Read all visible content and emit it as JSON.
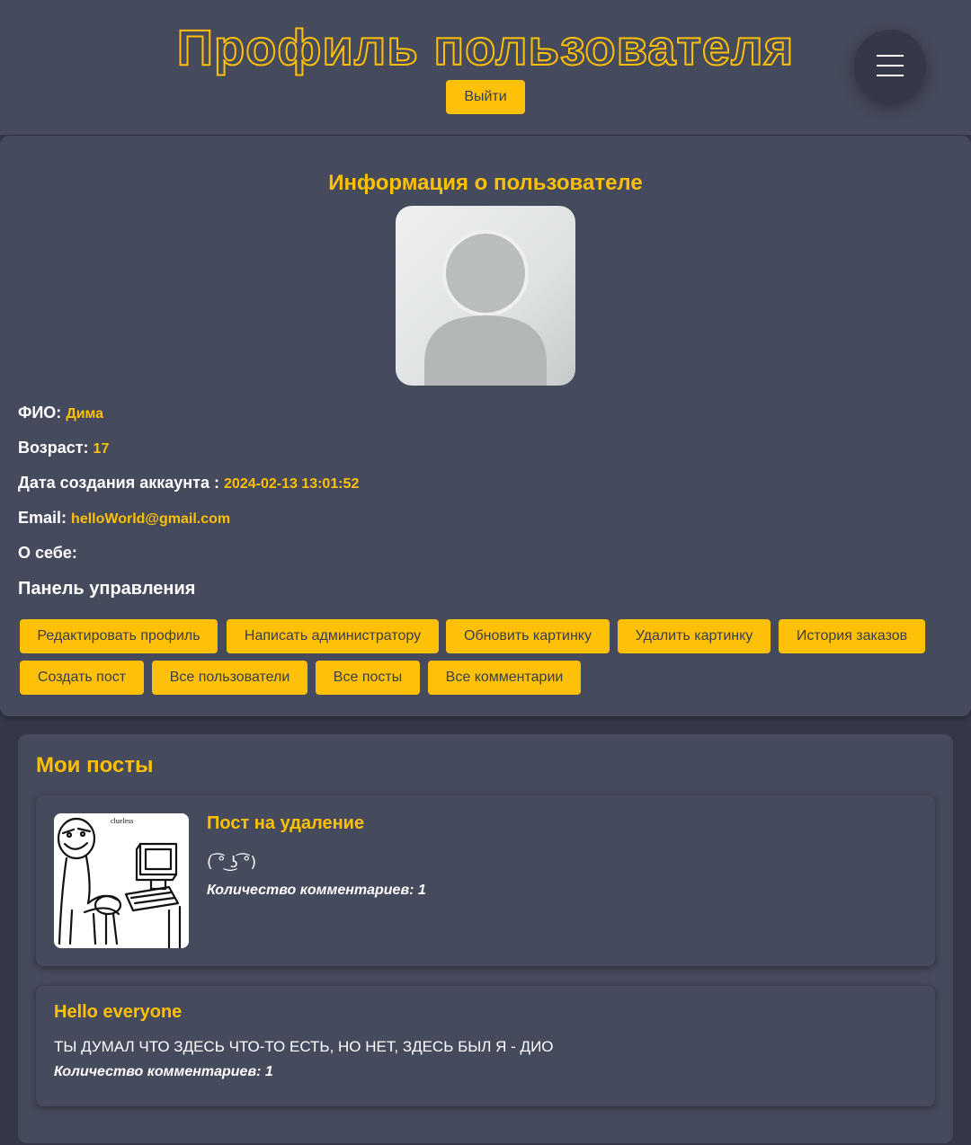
{
  "header": {
    "title": "Профиль пользователя",
    "logout_label": "Выйти"
  },
  "profile": {
    "section_title": "Информация о пользователе",
    "fields": {
      "name_label": "ФИО:",
      "name_value": "Дима",
      "age_label": "Возраст:",
      "age_value": "17",
      "created_label": "Дата создания аккаунта :",
      "created_value": "2024-02-13 13:01:52",
      "email_label": "Email:",
      "email_value": "helloWorld@gmail.com",
      "about_label": "О себе:"
    },
    "panel_title": "Панель управления",
    "buttons": [
      "Редактировать профиль",
      "Написать администратору",
      "Обновить картинку",
      "Удалить картинку",
      "История заказов",
      "Создать пост",
      "Все пользователи",
      "Все посты",
      "Все комментарии"
    ]
  },
  "posts": {
    "section_title": "Мои посты",
    "items": [
      {
        "title": "Пост на удаление",
        "text": "( ͡° ͜ʖ ͡°)",
        "comments": "Количество комментариев: 1",
        "image_caption": "clueless"
      },
      {
        "title": "Hello everyone",
        "text": "ТЫ ДУМАЛ ЧТО ЗДЕСЬ ЧТО-ТО ЕСТЬ, НО НЕТ, ЗДЕСЬ БЫЛ Я - ДИО",
        "comments": "Количество комментариев: 1"
      }
    ]
  },
  "colors": {
    "accent": "#ffc107",
    "background": "#343747",
    "card": "#454a5c"
  }
}
